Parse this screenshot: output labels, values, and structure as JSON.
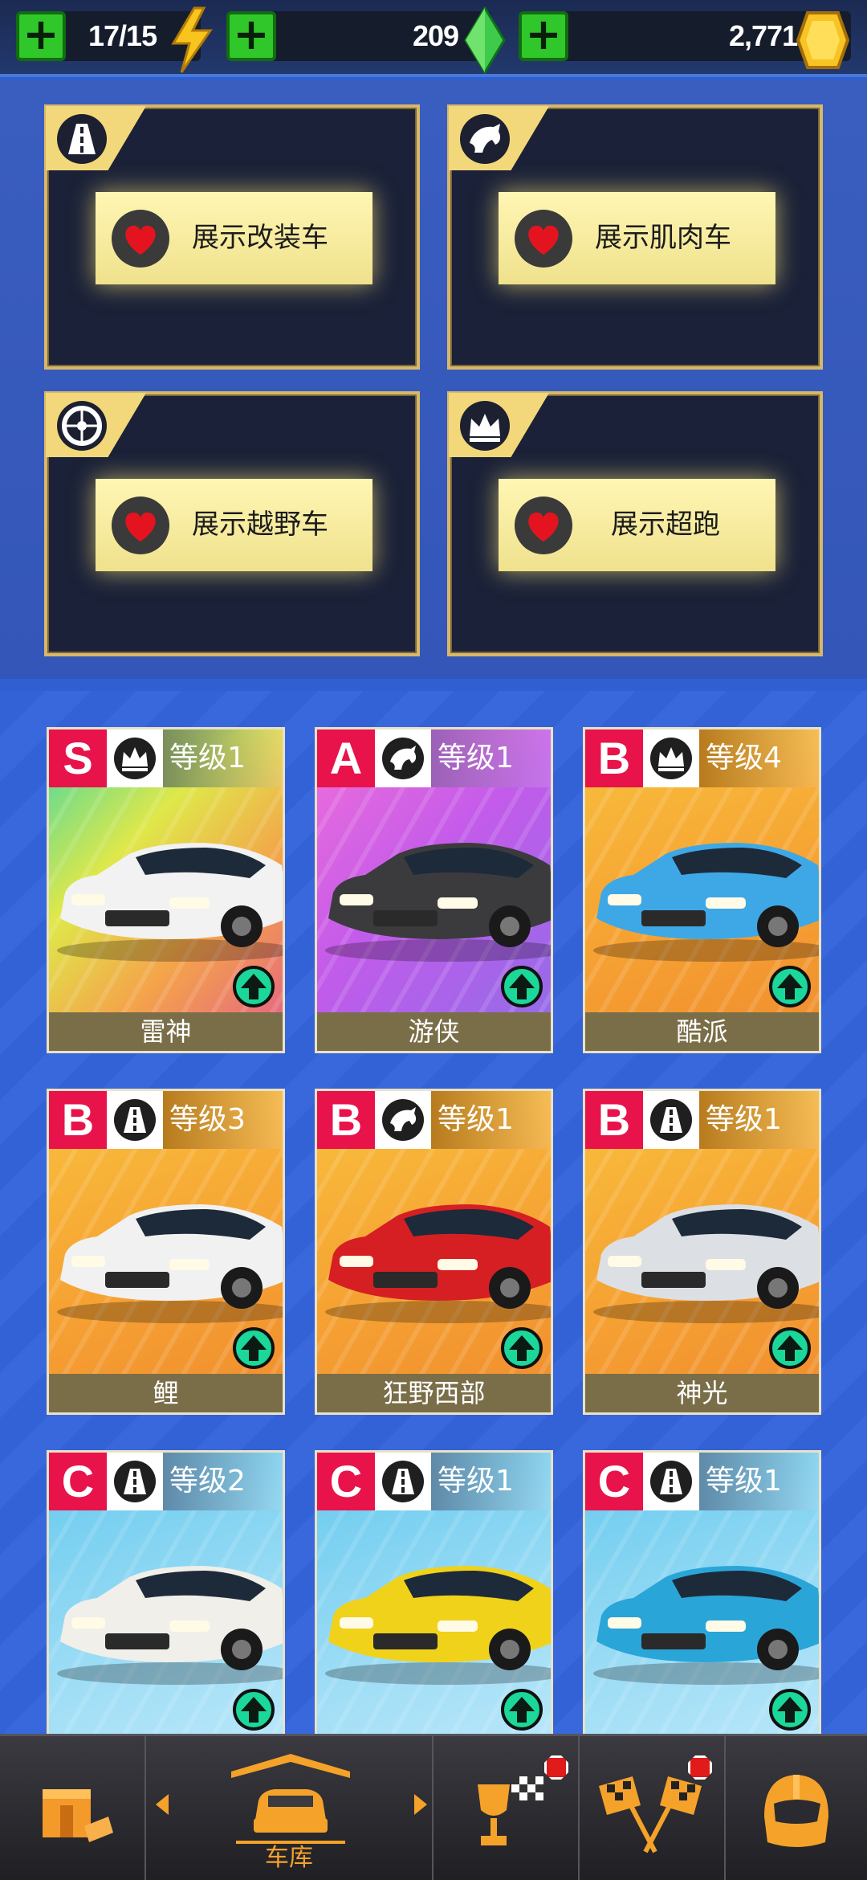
{
  "topbar": {
    "energy": "17/15",
    "gems": "209",
    "coins": "2,771",
    "plus_label": "+"
  },
  "showcases": [
    {
      "class_icon": "road-icon",
      "label": "展示改装车"
    },
    {
      "class_icon": "horse-icon",
      "label": "展示肌肉车"
    },
    {
      "class_icon": "wheel-icon",
      "label": "展示越野车"
    },
    {
      "class_icon": "crown-icon",
      "label": "展示超跑"
    }
  ],
  "cars": [
    {
      "rank": "S",
      "class_icon": "crown-icon",
      "level": "等级1",
      "name": "雷神",
      "color": "#f2f2f2"
    },
    {
      "rank": "A",
      "class_icon": "horse-icon",
      "level": "等级1",
      "name": "游侠",
      "color": "#3b3b3e"
    },
    {
      "rank": "B",
      "class_icon": "crown-icon",
      "level": "等级4",
      "name": "酷派",
      "color": "#3ea8e6"
    },
    {
      "rank": "B",
      "class_icon": "road-icon",
      "level": "等级3",
      "name": "鲤",
      "color": "#f1f1f1"
    },
    {
      "rank": "B",
      "class_icon": "horse-icon",
      "level": "等级1",
      "name": "狂野西部",
      "color": "#d51f22"
    },
    {
      "rank": "B",
      "class_icon": "road-icon",
      "level": "等级1",
      "name": "神光",
      "color": "#dcdfe3"
    },
    {
      "rank": "C",
      "class_icon": "road-icon",
      "level": "等级2",
      "name": "",
      "color": "#f0efe9"
    },
    {
      "rank": "C",
      "class_icon": "road-icon",
      "level": "等级1",
      "name": "",
      "color": "#f0d21a"
    },
    {
      "rank": "C",
      "class_icon": "road-icon",
      "level": "等级1",
      "name": "",
      "color": "#2aa5d8"
    }
  ],
  "bottomnav": {
    "garage_label": "车库",
    "items": [
      "shop-box-icon",
      "garage-car-icon",
      "trophy-flag-icon",
      "crossed-flags-icon",
      "helmet-icon"
    ]
  }
}
